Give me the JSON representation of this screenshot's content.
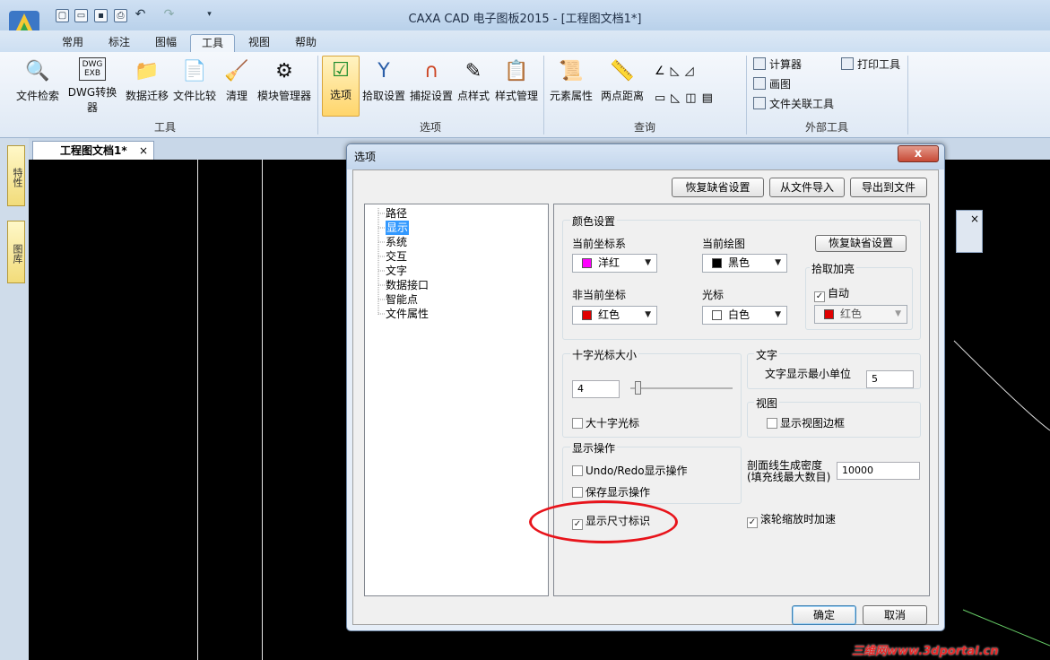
{
  "window": {
    "title": "CAXA CAD 电子图板2015 - [工程图文档1*]"
  },
  "quick_access": [
    "new",
    "open",
    "save",
    "print",
    "undo",
    "redo",
    "customize"
  ],
  "tabs": [
    {
      "label": "常用"
    },
    {
      "label": "标注"
    },
    {
      "label": "图幅"
    },
    {
      "label": "工具",
      "active": true
    },
    {
      "label": "视图"
    },
    {
      "label": "帮助"
    }
  ],
  "ribbon": {
    "tools": [
      "文件检索",
      "DWG转换器",
      "数据迁移",
      "文件比较",
      "清理",
      "模块管理器"
    ],
    "options": [
      "选项",
      "拾取设置",
      "捕捉设置",
      "点样式",
      "样式管理"
    ],
    "query": [
      "元素属性",
      "两点距离"
    ],
    "external": [
      "计算器",
      "画图",
      "文件关联工具",
      "打印工具"
    ],
    "groups": {
      "tools": "工具",
      "options": "选项",
      "query": "查询",
      "external": "外部工具"
    },
    "dwg_icon_text": {
      "top": "DWG",
      "bottom": "EXB"
    }
  },
  "left_dock": [
    "特性",
    "图库"
  ],
  "doc_tab": {
    "label": "工程图文档1*",
    "close": "×"
  },
  "dialog": {
    "title": "选项",
    "close": "x",
    "top_buttons": [
      "恢复缺省设置",
      "从文件导入",
      "导出到文件"
    ],
    "tree": [
      "路径",
      "显示",
      "系统",
      "交互",
      "文字",
      "数据接口",
      "智能点",
      "文件属性"
    ],
    "tree_selected": "显示",
    "color_settings": {
      "group": "颜色设置",
      "current_coord_label": "当前坐标系",
      "current_coord_value": "洋红",
      "current_coord_color": "#ff00ff",
      "current_draw_label": "当前绘图",
      "current_draw_value": "黑色",
      "current_draw_color": "#000000",
      "restore_button": "恢复缺省设置",
      "noncurrent_label": "非当前坐标",
      "noncurrent_value": "红色",
      "noncurrent_color": "#e00000",
      "cursor_label": "光标",
      "cursor_value": "白色",
      "cursor_color": "#ffffff",
      "pick_group": "拾取加亮",
      "auto_label": "自动",
      "auto_checked": true,
      "pick_value": "红色",
      "pick_color": "#e00000"
    },
    "cross_cursor": {
      "group": "十字光标大小",
      "value": "4",
      "slider_fraction": 0.07,
      "large_label": "大十字光标",
      "large_checked": false
    },
    "text": {
      "group": "文字",
      "min_unit_label": "文字显示最小单位",
      "min_unit_value": "5"
    },
    "view": {
      "group": "视图",
      "show_border_label": "显示视图边框",
      "show_border_checked": false
    },
    "display_ops": {
      "group": "显示操作",
      "undo_redo_label": "Undo/Redo显示操作",
      "undo_redo_checked": false,
      "save_label": "保存显示操作",
      "save_checked": false,
      "dim_label": "显示尺寸标识",
      "dim_checked": true
    },
    "hatch": {
      "label_line1": "剖面线生成密度",
      "label_line2": "(填充线最大数目)",
      "value": "10000"
    },
    "wheel": {
      "label": "滚轮缩放时加速",
      "checked": true
    },
    "ok": "确定",
    "cancel": "取消"
  },
  "float_panel": {
    "close": "×"
  },
  "watermark": "三维网www.3dportal.cn",
  "colors": {
    "highlight": "#e8141b",
    "selection": "#3399ff"
  }
}
